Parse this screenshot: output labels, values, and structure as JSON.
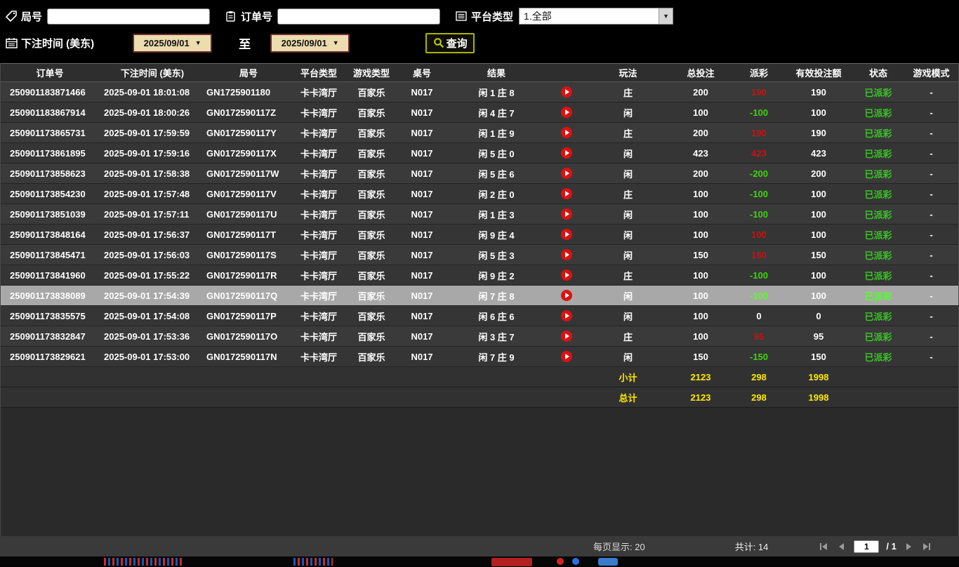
{
  "filters": {
    "round_label": "局号",
    "order_label": "订单号",
    "platform_label": "平台类型",
    "platform_value": "1.全部",
    "bet_time_label": "下注时间 (美东)",
    "date_from": "2025/09/01",
    "to_label": "至",
    "date_to": "2025/09/01",
    "search_label": "查询"
  },
  "icons": {
    "round": "tag-icon",
    "order": "clipboard-icon",
    "platform": "list-icon",
    "bet_time": "calendar-icon",
    "search": "magnifier-icon",
    "play": "play-icon",
    "dropdown": "chevron-down-icon"
  },
  "table": {
    "headers": [
      "订单号",
      "下注时间 (美东)",
      "局号",
      "平台类型",
      "游戏类型",
      "桌号",
      "结果",
      "",
      "玩法",
      "总投注",
      "派彩",
      "有效投注额",
      "状态",
      "游戏模式"
    ],
    "rows": [
      {
        "order": "250901183871466",
        "time": "2025-09-01 18:01:08",
        "round": "GN1725901180",
        "platform": "卡卡湾厅",
        "game": "百家乐",
        "table_no": "N017",
        "result": "闲 1 庄 8",
        "bet": "庄",
        "total": "200",
        "payout": "190",
        "payout_class": "win",
        "valid": "190",
        "status": "已派彩",
        "mode": "-"
      },
      {
        "order": "250901183867914",
        "time": "2025-09-01 18:00:26",
        "round": "GN0172590117Z",
        "platform": "卡卡湾厅",
        "game": "百家乐",
        "table_no": "N017",
        "result": "闲 4 庄 7",
        "bet": "闲",
        "total": "100",
        "payout": "-100",
        "payout_class": "loss",
        "valid": "100",
        "status": "已派彩",
        "mode": "-"
      },
      {
        "order": "250901173865731",
        "time": "2025-09-01 17:59:59",
        "round": "GN0172590117Y",
        "platform": "卡卡湾厅",
        "game": "百家乐",
        "table_no": "N017",
        "result": "闲 1 庄 9",
        "bet": "庄",
        "total": "200",
        "payout": "190",
        "payout_class": "win",
        "valid": "190",
        "status": "已派彩",
        "mode": "-"
      },
      {
        "order": "250901173861895",
        "time": "2025-09-01 17:59:16",
        "round": "GN0172590117X",
        "platform": "卡卡湾厅",
        "game": "百家乐",
        "table_no": "N017",
        "result": "闲 5 庄 0",
        "bet": "闲",
        "total": "423",
        "payout": "423",
        "payout_class": "win",
        "valid": "423",
        "status": "已派彩",
        "mode": "-"
      },
      {
        "order": "250901173858623",
        "time": "2025-09-01 17:58:38",
        "round": "GN0172590117W",
        "platform": "卡卡湾厅",
        "game": "百家乐",
        "table_no": "N017",
        "result": "闲 5 庄 6",
        "bet": "闲",
        "total": "200",
        "payout": "-200",
        "payout_class": "loss",
        "valid": "200",
        "status": "已派彩",
        "mode": "-"
      },
      {
        "order": "250901173854230",
        "time": "2025-09-01 17:57:48",
        "round": "GN0172590117V",
        "platform": "卡卡湾厅",
        "game": "百家乐",
        "table_no": "N017",
        "result": "闲 2 庄 0",
        "bet": "庄",
        "total": "100",
        "payout": "-100",
        "payout_class": "loss",
        "valid": "100",
        "status": "已派彩",
        "mode": "-"
      },
      {
        "order": "250901173851039",
        "time": "2025-09-01 17:57:11",
        "round": "GN0172590117U",
        "platform": "卡卡湾厅",
        "game": "百家乐",
        "table_no": "N017",
        "result": "闲 1 庄 3",
        "bet": "闲",
        "total": "100",
        "payout": "-100",
        "payout_class": "loss",
        "valid": "100",
        "status": "已派彩",
        "mode": "-"
      },
      {
        "order": "250901173848164",
        "time": "2025-09-01 17:56:37",
        "round": "GN0172590117T",
        "platform": "卡卡湾厅",
        "game": "百家乐",
        "table_no": "N017",
        "result": "闲 9 庄 4",
        "bet": "闲",
        "total": "100",
        "payout": "100",
        "payout_class": "win",
        "valid": "100",
        "status": "已派彩",
        "mode": "-"
      },
      {
        "order": "250901173845471",
        "time": "2025-09-01 17:56:03",
        "round": "GN0172590117S",
        "platform": "卡卡湾厅",
        "game": "百家乐",
        "table_no": "N017",
        "result": "闲 5 庄 3",
        "bet": "闲",
        "total": "150",
        "payout": "150",
        "payout_class": "win",
        "valid": "150",
        "status": "已派彩",
        "mode": "-"
      },
      {
        "order": "250901173841960",
        "time": "2025-09-01 17:55:22",
        "round": "GN0172590117R",
        "platform": "卡卡湾厅",
        "game": "百家乐",
        "table_no": "N017",
        "result": "闲 9 庄 2",
        "bet": "庄",
        "total": "100",
        "payout": "-100",
        "payout_class": "loss",
        "valid": "100",
        "status": "已派彩",
        "mode": "-"
      },
      {
        "order": "250901173838089",
        "time": "2025-09-01 17:54:39",
        "round": "GN0172590117Q",
        "platform": "卡卡湾厅",
        "game": "百家乐",
        "table_no": "N017",
        "result": "闲 7 庄 8",
        "bet": "闲",
        "total": "100",
        "payout": "-100",
        "payout_class": "loss",
        "valid": "100",
        "status": "已派彩",
        "mode": "-",
        "selected": true
      },
      {
        "order": "250901173835575",
        "time": "2025-09-01 17:54:08",
        "round": "GN0172590117P",
        "platform": "卡卡湾厅",
        "game": "百家乐",
        "table_no": "N017",
        "result": "闲 6 庄 6",
        "bet": "闲",
        "total": "100",
        "payout": "0",
        "payout_class": "zero",
        "valid": "0",
        "status": "已派彩",
        "mode": "-"
      },
      {
        "order": "250901173832847",
        "time": "2025-09-01 17:53:36",
        "round": "GN0172590117O",
        "platform": "卡卡湾厅",
        "game": "百家乐",
        "table_no": "N017",
        "result": "闲 3 庄 7",
        "bet": "庄",
        "total": "100",
        "payout": "95",
        "payout_class": "win",
        "valid": "95",
        "status": "已派彩",
        "mode": "-"
      },
      {
        "order": "250901173829621",
        "time": "2025-09-01 17:53:00",
        "round": "GN0172590117N",
        "platform": "卡卡湾厅",
        "game": "百家乐",
        "table_no": "N017",
        "result": "闲 7 庄 9",
        "bet": "闲",
        "total": "150",
        "payout": "-150",
        "payout_class": "loss",
        "valid": "150",
        "status": "已派彩",
        "mode": "-"
      }
    ],
    "subtotal": {
      "label": "小计",
      "total_bet": "2123",
      "payout": "298",
      "valid_bet": "1998"
    },
    "total": {
      "label": "总计",
      "total_bet": "2123",
      "payout": "298",
      "valid_bet": "1998"
    }
  },
  "footer": {
    "per_page": "每页显示: 20",
    "total_count": "共计: 14",
    "page": "1",
    "page_suffix": "/  1"
  }
}
